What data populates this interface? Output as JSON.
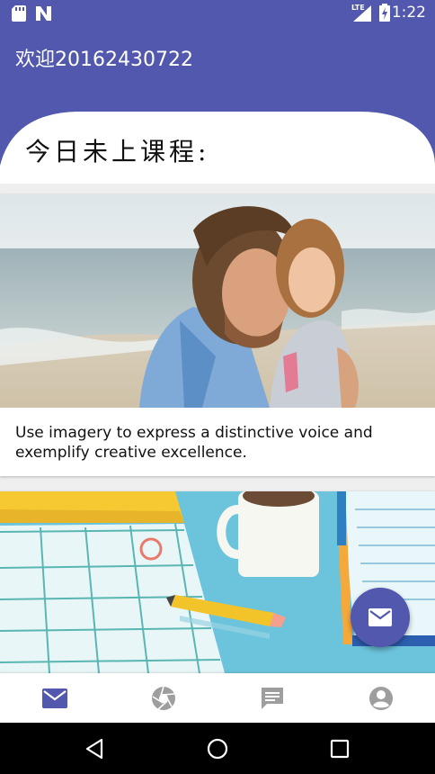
{
  "status_bar": {
    "time": "1:22",
    "network_label": "LTE",
    "icons": [
      "sd-card-icon",
      "notification-n-icon",
      "signal-lte-icon",
      "battery-charging-icon"
    ]
  },
  "app_bar": {
    "title": "欢迎20162430722"
  },
  "header": {
    "title": "今日未上课程:"
  },
  "cards": [
    {
      "image": "father-and-child-at-beach",
      "text": "Use imagery to express a distinctive voice and exemplify creative excellence."
    },
    {
      "image": "calendar-coffee-pencil-illustration"
    }
  ],
  "fab": {
    "icon": "mail-icon"
  },
  "bottom_nav": {
    "items": [
      {
        "icon": "mail-icon",
        "active": true
      },
      {
        "icon": "camera-aperture-icon",
        "active": false
      },
      {
        "icon": "chat-message-icon",
        "active": false
      },
      {
        "icon": "account-icon",
        "active": false
      }
    ]
  },
  "system_nav": {
    "buttons": [
      "back-icon",
      "home-icon",
      "recents-icon"
    ]
  },
  "colors": {
    "primary": "#5158ad",
    "active_icon": "#5158ad",
    "inactive_icon": "#9e9e9e",
    "background": "#efeff0"
  }
}
